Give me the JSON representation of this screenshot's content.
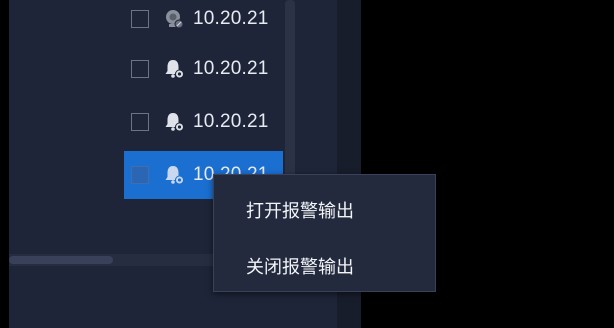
{
  "device_list": {
    "items": [
      {
        "ip": "10.20.21",
        "icon": "camera-offline-icon",
        "checked": false,
        "selected": false
      },
      {
        "ip": "10.20.21",
        "icon": "alarm-output-icon",
        "checked": false,
        "selected": false
      },
      {
        "ip": "10.20.21",
        "icon": "alarm-output-icon",
        "checked": false,
        "selected": false
      },
      {
        "ip": "10.20.21",
        "icon": "alarm-output-icon",
        "checked": false,
        "selected": true
      }
    ]
  },
  "context_menu": {
    "items": [
      {
        "label": "打开报警输出"
      },
      {
        "label": "关闭报警输出"
      }
    ]
  },
  "colors": {
    "panel_bg": "#1e2538",
    "selection": "#1a6fd1",
    "menu_bg": "#232a3d",
    "text": "#e8ebf2"
  }
}
